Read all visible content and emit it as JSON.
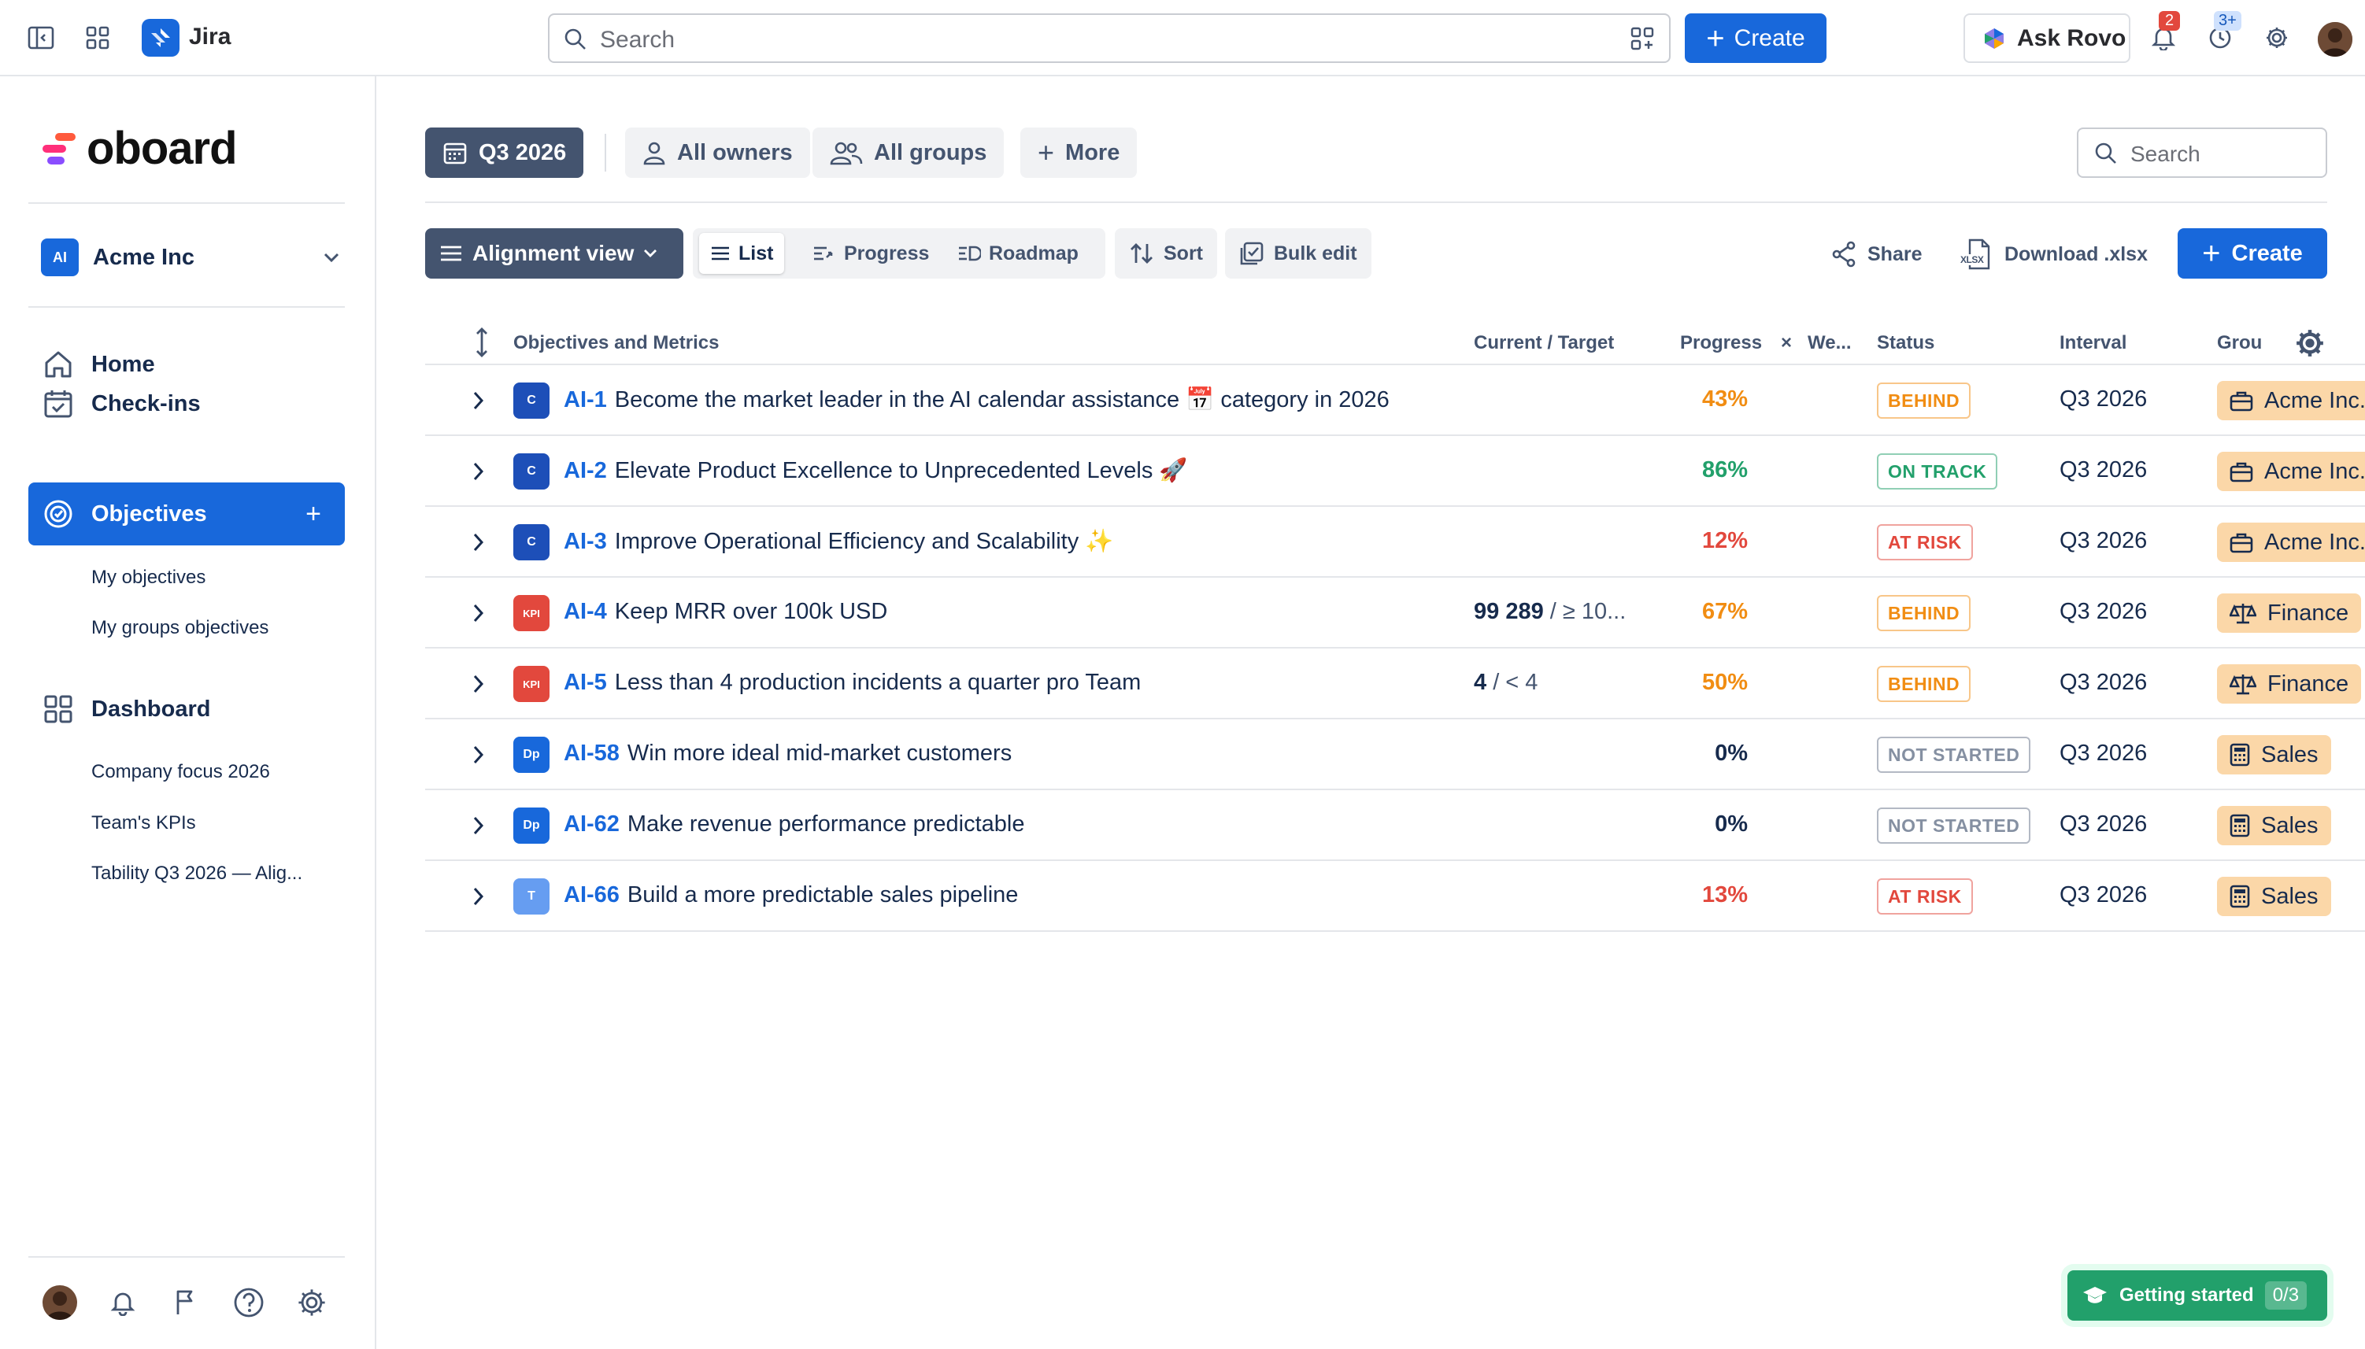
{
  "topbar": {
    "app_name": "Jira",
    "search_placeholder": "Search",
    "create_label": "Create",
    "ask_rovo_label": "Ask Rovo",
    "notifications_count": "2",
    "updates_count": "3+"
  },
  "sidebar": {
    "brand": "oboard",
    "org_badge": "AI",
    "org_name": "Acme Inc",
    "nav": {
      "home": "Home",
      "checkins": "Check-ins",
      "objectives": "Objectives",
      "objectives_plus": "+",
      "my_objectives": "My objectives",
      "my_groups_objectives": "My groups objectives",
      "dashboard": "Dashboard",
      "dash_items": [
        "Company focus 2026",
        "Team's KPIs",
        "Tability Q3 2026 — Alig..."
      ]
    }
  },
  "filters": {
    "interval": "Q3 2026",
    "owners": "All owners",
    "groups": "All groups",
    "more": "More",
    "search_placeholder": "Search"
  },
  "toolbar": {
    "view": "Alignment view",
    "list": "List",
    "progress": "Progress",
    "roadmap": "Roadmap",
    "sort": "Sort",
    "bulk_edit": "Bulk edit",
    "share": "Share",
    "download": "Download .xlsx",
    "xlsx_badge": "XLSX",
    "create": "Create"
  },
  "table": {
    "headers": {
      "objectives": "Objectives and Metrics",
      "current_target": "Current / Target",
      "progress": "Progress",
      "weight_x": "×",
      "weight": "We...",
      "status": "Status",
      "interval": "Interval",
      "group": "Grou"
    },
    "rows": [
      {
        "badge": "C",
        "badge_color": "#1d4fb8",
        "key": "AI-1",
        "title": "Become the market leader in the AI calendar assistance 📅 category in 2026",
        "current": "",
        "target": "",
        "progress": "43%",
        "progress_color": "#f18d13",
        "status": "BEHIND",
        "status_color": "#f18d13",
        "interval": "Q3 2026",
        "group": "Acme Inc.",
        "group_icon": "briefcase-icon"
      },
      {
        "badge": "C",
        "badge_color": "#1d4fb8",
        "key": "AI-2",
        "title": "Elevate Product Excellence to Unprecedented Levels 🚀",
        "current": "",
        "target": "",
        "progress": "86%",
        "progress_color": "#22a06b",
        "status": "ON TRACK",
        "status_color": "#22a06b",
        "interval": "Q3 2026",
        "group": "Acme Inc.",
        "group_icon": "briefcase-icon"
      },
      {
        "badge": "C",
        "badge_color": "#1d4fb8",
        "key": "AI-3",
        "title": "Improve Operational Efficiency and Scalability ✨",
        "current": "",
        "target": "",
        "progress": "12%",
        "progress_color": "#e2483d",
        "status": "AT RISK",
        "status_color": "#e2483d",
        "interval": "Q3 2026",
        "group": "Acme Inc.",
        "group_icon": "briefcase-icon"
      },
      {
        "badge": "KPI",
        "badge_color": "#e2483d",
        "key": "AI-4",
        "title": "Keep MRR over 100k USD",
        "current": "99 289",
        "target": " / ≥ 10...",
        "progress": "67%",
        "progress_color": "#f18d13",
        "status": "BEHIND",
        "status_color": "#f18d13",
        "interval": "Q3 2026",
        "group": "Finance",
        "group_icon": "scales-icon"
      },
      {
        "badge": "KPI",
        "badge_color": "#e2483d",
        "key": "AI-5",
        "title": "Less than 4 production incidents a quarter pro Team",
        "current": "4",
        "target": " / < 4",
        "progress": "50%",
        "progress_color": "#f18d13",
        "status": "BEHIND",
        "status_color": "#f18d13",
        "interval": "Q3 2026",
        "group": "Finance",
        "group_icon": "scales-icon"
      },
      {
        "badge": "Dp",
        "badge_color": "#1868db",
        "key": "AI-58",
        "title": "Win more ideal mid-market customers",
        "current": "",
        "target": "",
        "progress": "0%",
        "progress_color": "#172b4d",
        "status": "NOT STARTED",
        "status_color": "#8590a2",
        "interval": "Q3 2026",
        "group": "Sales",
        "group_icon": "calculator-icon"
      },
      {
        "badge": "Dp",
        "badge_color": "#1868db",
        "key": "AI-62",
        "title": "Make revenue performance predictable",
        "current": "",
        "target": "",
        "progress": "0%",
        "progress_color": "#172b4d",
        "status": "NOT STARTED",
        "status_color": "#8590a2",
        "interval": "Q3 2026",
        "group": "Sales",
        "group_icon": "calculator-icon"
      },
      {
        "badge": "T",
        "badge_color": "#669df1",
        "key": "AI-66",
        "title": "Build a more predictable sales pipeline",
        "current": "",
        "target": "",
        "progress": "13%",
        "progress_color": "#e2483d",
        "status": "AT RISK",
        "status_color": "#e2483d",
        "interval": "Q3 2026",
        "group": "Sales",
        "group_icon": "calculator-icon"
      }
    ]
  },
  "getting_started": {
    "label": "Getting started",
    "count": "0/3"
  },
  "colors": {
    "accent": "#1868db",
    "dark_chip": "#44546f",
    "group_chip": "#fbd7a8",
    "success": "#22a06b"
  }
}
